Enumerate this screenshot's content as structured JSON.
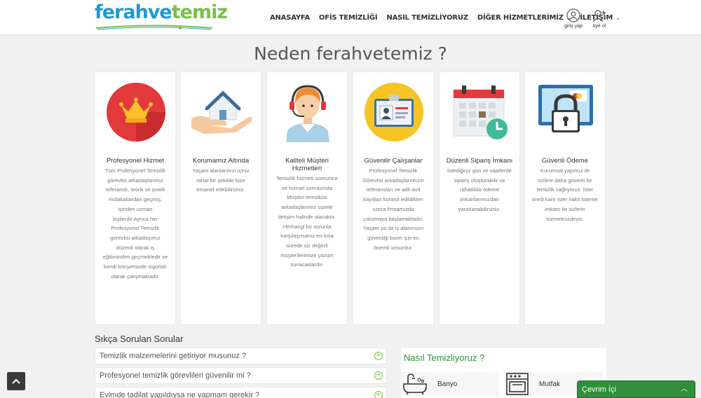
{
  "header": {
    "logo_part1": "ferahve",
    "logo_part2": "temiz",
    "nav": [
      {
        "label": "ANASAYFA",
        "dropdown": false
      },
      {
        "label": "OFİS TEMİZLİĞİ",
        "dropdown": false
      },
      {
        "label": "NASIL TEMİZLİYORUZ",
        "dropdown": false
      },
      {
        "label": "DİĞER HİZMETLERİMİZ",
        "dropdown": true
      },
      {
        "label": "İLETİŞİM",
        "dropdown": true
      }
    ],
    "login_label": "giriş yap",
    "signup_label": "üye ol"
  },
  "why": {
    "title": "Neden ferahvetemiz ?",
    "cards": [
      {
        "title": "Profesyonel Hizmet",
        "icon": "crown-icon",
        "desc": "Tüm Profesyonel Temizlik görevlisi arkadaşlarımız referanslı, teorik ve pratik mülakatlardan geçmiş, işinden uzman kişilerdir.Ayrıca her Profesyonel Temizlik görevlisi arkadaşımız düzenli olarak iş eğitiminden geçmektedir ve kendi bünyemizde sigortalı olarak çalışmaktadır."
      },
      {
        "title": "Korumamız Altında",
        "icon": "house-hand-icon",
        "desc": "Yaşam alanlarınızı içiniz rahat bir şekilde bize emanet edebilirsiniz."
      },
      {
        "title": "Kaliteli Müşteri Hizmetleri",
        "icon": "support-agent-icon",
        "desc": "Temizlik hizmeti süresince ve hizmet sonrasında Müşteri temsilcisi arkadaşlarımız sizinle iletişim halinde olacaktır. Herhangi bir sorunla karşılaşırsanız en kısa sürede siz değerli müşterilerimize çözüm sunacaklardır."
      },
      {
        "title": "Güvenilir Çalışanlar",
        "icon": "id-card-icon",
        "desc": "Profesyonel Temizlik Görevlisi arkadaşlarımızın referansları ve adli sicil kayıtları kontrol edildikten sonra firmamızda çalışmaya başlamaktadır. Yaşam ya da iş alanınızın güvenliği bizim için en önemli unsurdur."
      },
      {
        "title": "Düzenli Sipariş İmkanı",
        "icon": "calendar-clock-icon",
        "desc": "İstediğiniz gün ve saatlerde sipariş oluşturabilir ve rahatlıkla ödeme imkanlarımızdan yararlanabilirsiniz."
      },
      {
        "title": "Güvenli Ödeme",
        "icon": "secure-payment-icon",
        "desc": "Kurumsal yapımız ile sizlere daha güvenli bir temizlik sağlıyoruz. İster kredi kartı ister nakit ödeme imkanı ile sizlerin hizmetinizdeyiz."
      }
    ]
  },
  "faq": {
    "title": "Sıkça Sorulan Sorular",
    "items": [
      "Temizlik malzemelerini getiriyor musunuz ?",
      "Profesyonel temizlik görevlileri güvenilir mi ?",
      "Evimde tadilat yapıldıysa ne yapmam gerekir ?"
    ]
  },
  "how": {
    "title": "Nasıl Temizliyoruz ?",
    "items": [
      {
        "label": "Banyo",
        "icon": "bathtub-icon"
      },
      {
        "label": "Mutfak",
        "icon": "kitchen-icon"
      }
    ]
  },
  "chat": {
    "label": "Çevrim İçi"
  },
  "colors": {
    "brand_blue": "#1d9bd6",
    "brand_green": "#7ac143",
    "chat_green": "#2f8f3a"
  }
}
